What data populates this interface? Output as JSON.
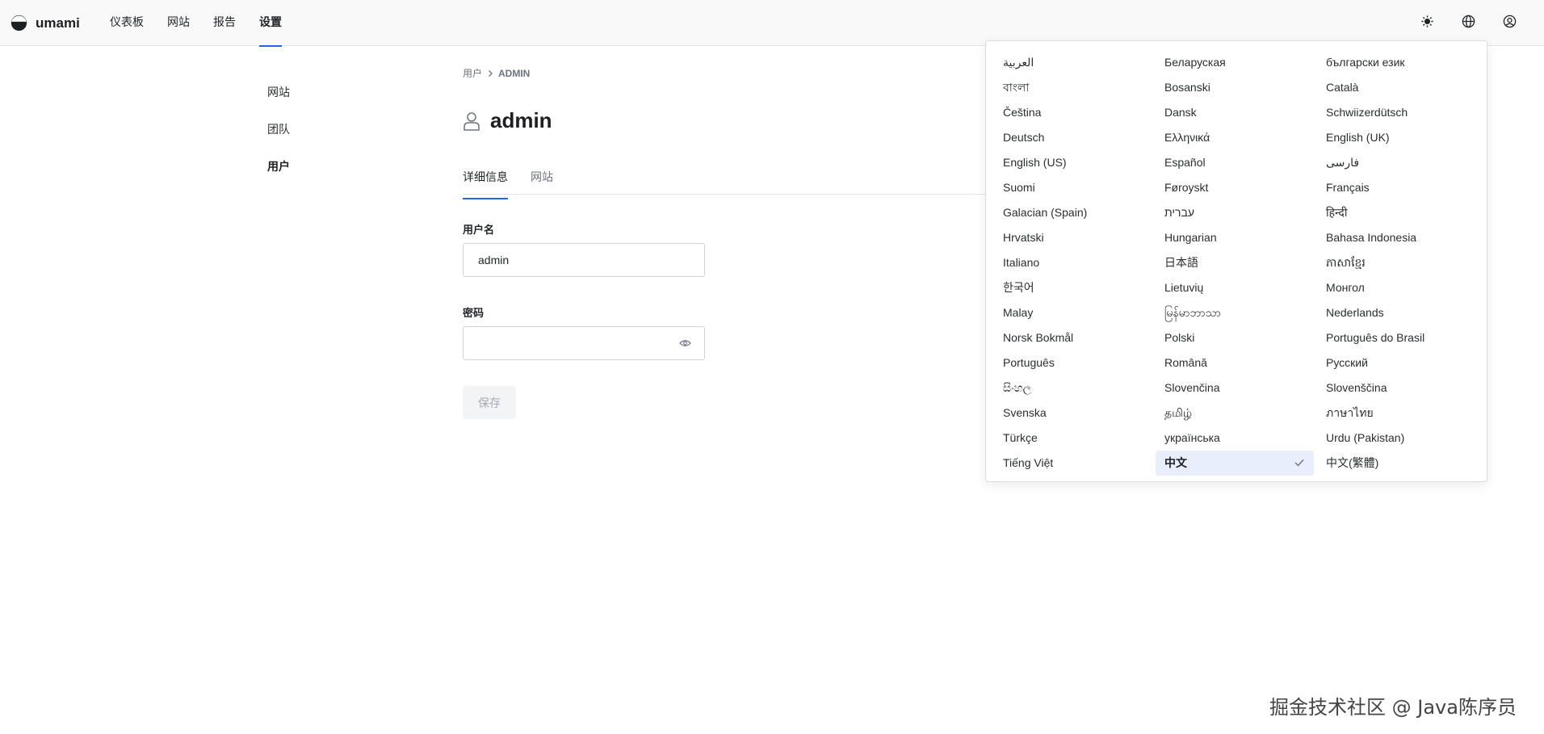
{
  "app": {
    "name": "umami"
  },
  "nav": {
    "items": [
      {
        "label": "仪表板"
      },
      {
        "label": "网站"
      },
      {
        "label": "报告"
      },
      {
        "label": "设置"
      }
    ]
  },
  "header_icons": [
    "sun-icon",
    "globe-icon",
    "user-circle-icon"
  ],
  "sidebar": {
    "items": [
      {
        "label": "网站"
      },
      {
        "label": "团队"
      },
      {
        "label": "用户"
      }
    ]
  },
  "breadcrumb": {
    "parent": "用户",
    "current": "ADMIN"
  },
  "page": {
    "title": "admin"
  },
  "tabs": [
    {
      "label": "详细信息"
    },
    {
      "label": "网站"
    }
  ],
  "form": {
    "username_label": "用户名",
    "username_value": "admin",
    "password_label": "密码",
    "password_value": "",
    "save_label": "保存"
  },
  "languages": [
    "العربية",
    "Беларуская",
    "български език",
    "বাংলা",
    "Bosanski",
    "Català",
    "Čeština",
    "Dansk",
    "Schwiizerdütsch",
    "Deutsch",
    "Ελληνικά",
    "English (UK)",
    "English (US)",
    "Español",
    "فارسی",
    "Suomi",
    "Føroyskt",
    "Français",
    "Galacian (Spain)",
    "עברית",
    "हिन्दी",
    "Hrvatski",
    "Hungarian",
    "Bahasa Indonesia",
    "Italiano",
    "日本語",
    "ភាសាខ្មែរ",
    "한국어",
    "Lietuvių",
    "Монгол",
    "Malay",
    "မြန်မာဘာသာ",
    "Nederlands",
    "Norsk Bokmål",
    "Polski",
    "Português do Brasil",
    "Português",
    "Română",
    "Русский",
    "සිංහල",
    "Slovenčina",
    "Slovenščina",
    "Svenska",
    "தமிழ்",
    "ภาษาไทย",
    "Türkçe",
    "українська",
    "Urdu (Pakistan)",
    "Tiếng Việt",
    "中文",
    "中文(繁體)"
  ],
  "selected_language": "中文",
  "colors": {
    "accent": "#2563eb",
    "selected_bg": "#e8eefb"
  },
  "watermark": "掘金技术社区 @ Java陈序员"
}
